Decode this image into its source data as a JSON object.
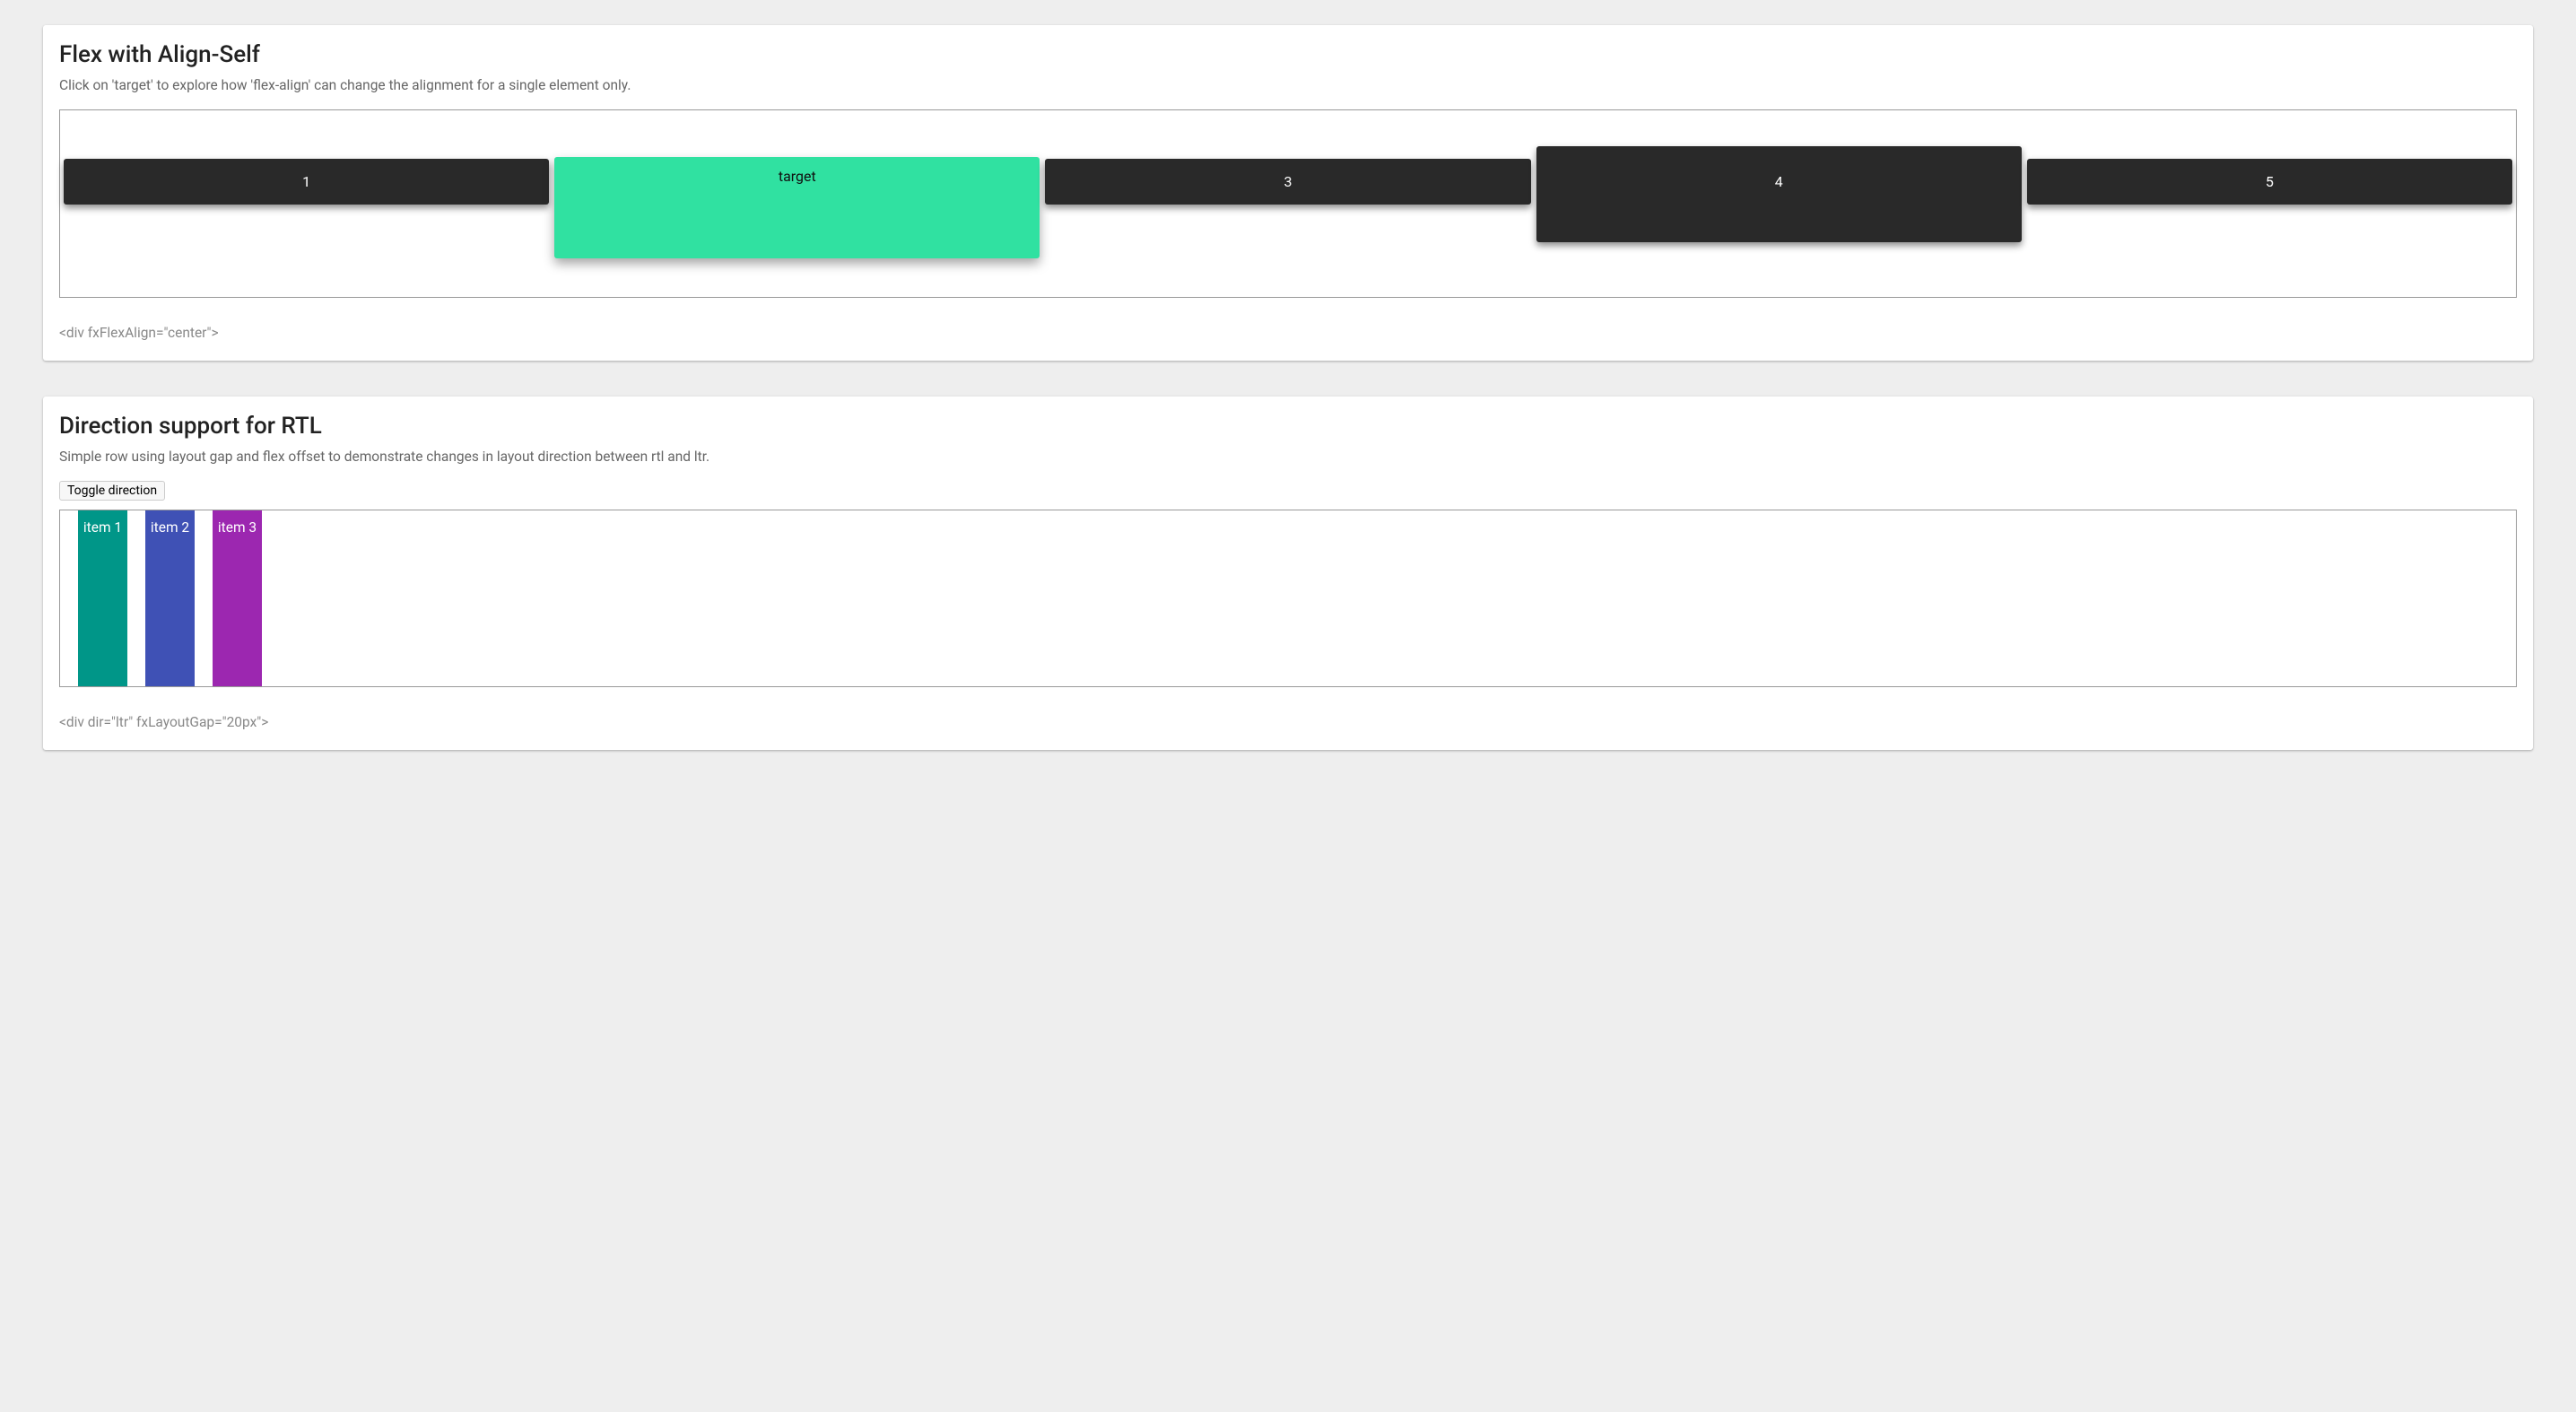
{
  "card1": {
    "title": "Flex with Align-Self",
    "subtitle": "Click on 'target' to explore how 'flex-align' can change the alignment for a single element only.",
    "items": [
      "1",
      "target",
      "3",
      "4",
      "5"
    ],
    "code_hint": "<div fxFlexAlign=\"center\">"
  },
  "card2": {
    "title": "Direction support for RTL",
    "subtitle": "Simple row using layout gap and flex offset to demonstrate changes in layout direction between rtl and ltr.",
    "toggle_label": "Toggle direction",
    "items": [
      "item 1",
      "item 2",
      "item 3"
    ],
    "code_hint": "<div dir=\"ltr\" fxLayoutGap=\"20px\">"
  }
}
